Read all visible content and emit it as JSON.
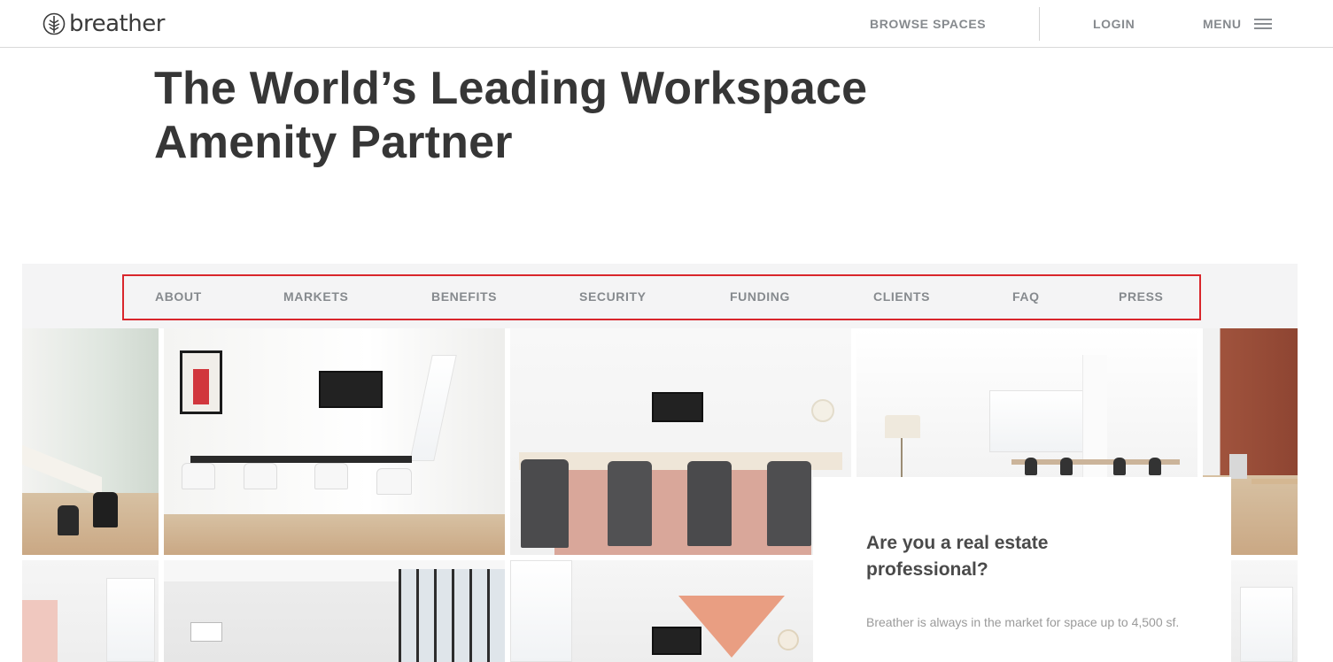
{
  "header": {
    "logo_text": "breather",
    "browse_label": "BROWSE SPACES",
    "login_label": "LOGIN",
    "menu_label": "MENU"
  },
  "hero": {
    "title_line1": "The World’s Leading Workspace",
    "title_line2": "Amenity Partner"
  },
  "subnav": {
    "items": [
      "ABOUT",
      "MARKETS",
      "BENEFITS",
      "SECURITY",
      "FUNDING",
      "CLIENTS",
      "FAQ",
      "PRESS"
    ]
  },
  "card": {
    "title": "Are you a real estate professional?",
    "text": "Breather is always in the market for space up to 4,500 sf."
  },
  "colors": {
    "accent_red": "#d9262c",
    "nav_gray": "#868a8e",
    "subnav_bg": "#f4f4f5"
  }
}
